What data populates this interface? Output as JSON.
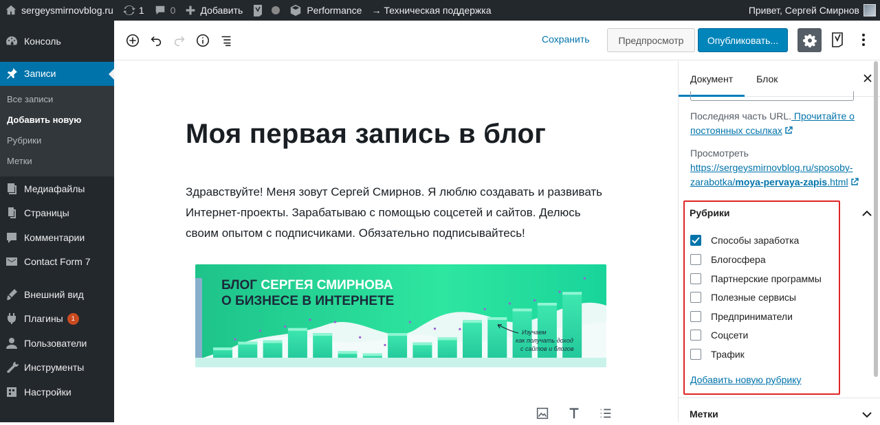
{
  "adminbar": {
    "site_name": "sergeysmirnovblog.ru",
    "updates_count": "1",
    "comments_count": "0",
    "add_label": "Добавить",
    "yoast_label": "",
    "performance_label": "Performance",
    "support_label": "→ Техническая поддержка",
    "greeting": "Привет, Сергей Смирнов"
  },
  "sidebar": {
    "items": [
      {
        "label": "Консоль",
        "icon": "dashboard-icon"
      },
      {
        "label": "Записи",
        "icon": "pin-icon"
      },
      {
        "label": "Медиафайлы",
        "icon": "media-icon"
      },
      {
        "label": "Страницы",
        "icon": "pages-icon"
      },
      {
        "label": "Комментарии",
        "icon": "comments-icon"
      },
      {
        "label": "Contact Form 7",
        "icon": "mail-icon"
      },
      {
        "label": "Внешний вид",
        "icon": "appearance-icon"
      },
      {
        "label": "Плагины",
        "icon": "plugins-icon",
        "badge": "1"
      },
      {
        "label": "Пользователи",
        "icon": "users-icon"
      },
      {
        "label": "Инструменты",
        "icon": "tools-icon"
      },
      {
        "label": "Настройки",
        "icon": "settings-icon"
      }
    ],
    "submenu": [
      "Все записи",
      "Добавить новую",
      "Рубрики",
      "Метки"
    ]
  },
  "toolbar": {
    "save_label": "Сохранить",
    "preview_label": "Предпросмотр",
    "publish_label": "Опубликовать..."
  },
  "post": {
    "title": "Моя первая запись в блог",
    "paragraph": "Здравствуйте! Меня зовут Сергей Смирнов. Я люблю создавать и развивать Интернет-проекты. Зарабатываю с помощью соцсетей и сайтов. Делюсь своим опытом с подписчиками. Обязательно подписывайтесь!",
    "banner": {
      "line1a": "БЛОГ",
      "line1b": " СЕРГЕЯ СМИРНОВА",
      "line2": "О БИЗНЕСЕ В ИНТЕРНЕТЕ",
      "note1": "Изучаем",
      "note2": "как получать доход",
      "note3": "с сайтов и блогов",
      "bar_levels": [
        0.18,
        0.26,
        0.28,
        0.45,
        0.38,
        0.13,
        0.1,
        0.38,
        0.25,
        0.32,
        0.56,
        0.6,
        0.72,
        0.8,
        0.95
      ]
    }
  },
  "panel": {
    "tab_document": "Документ",
    "tab_block": "Блок",
    "url_hint": "Последняя часть URL.",
    "url_link": " Прочитайте о постоянных ссылках",
    "view_label": "Просмотреть",
    "view_url_a": "https://sergeysmirnovblog.ru/sposoby-zarabotka/",
    "view_url_b": "moya-pervaya-zapis",
    "view_url_c": ".html",
    "rubrics_title": "Рубрики",
    "categories": [
      {
        "label": "Способы заработка",
        "checked": true
      },
      {
        "label": "Блогосфера",
        "checked": false
      },
      {
        "label": "Партнерские программы",
        "checked": false
      },
      {
        "label": "Полезные сервисы",
        "checked": false
      },
      {
        "label": "Предприниматели",
        "checked": false
      },
      {
        "label": "Соцсети",
        "checked": false
      },
      {
        "label": "Трафик",
        "checked": false
      }
    ],
    "add_category": "Добавить новую рубрику",
    "tags_title": "Метки"
  },
  "colors": {
    "accent": "#0073aa",
    "publish": "#0085ba",
    "admin_bg": "#23282d",
    "highlight_border": "#e02424"
  }
}
